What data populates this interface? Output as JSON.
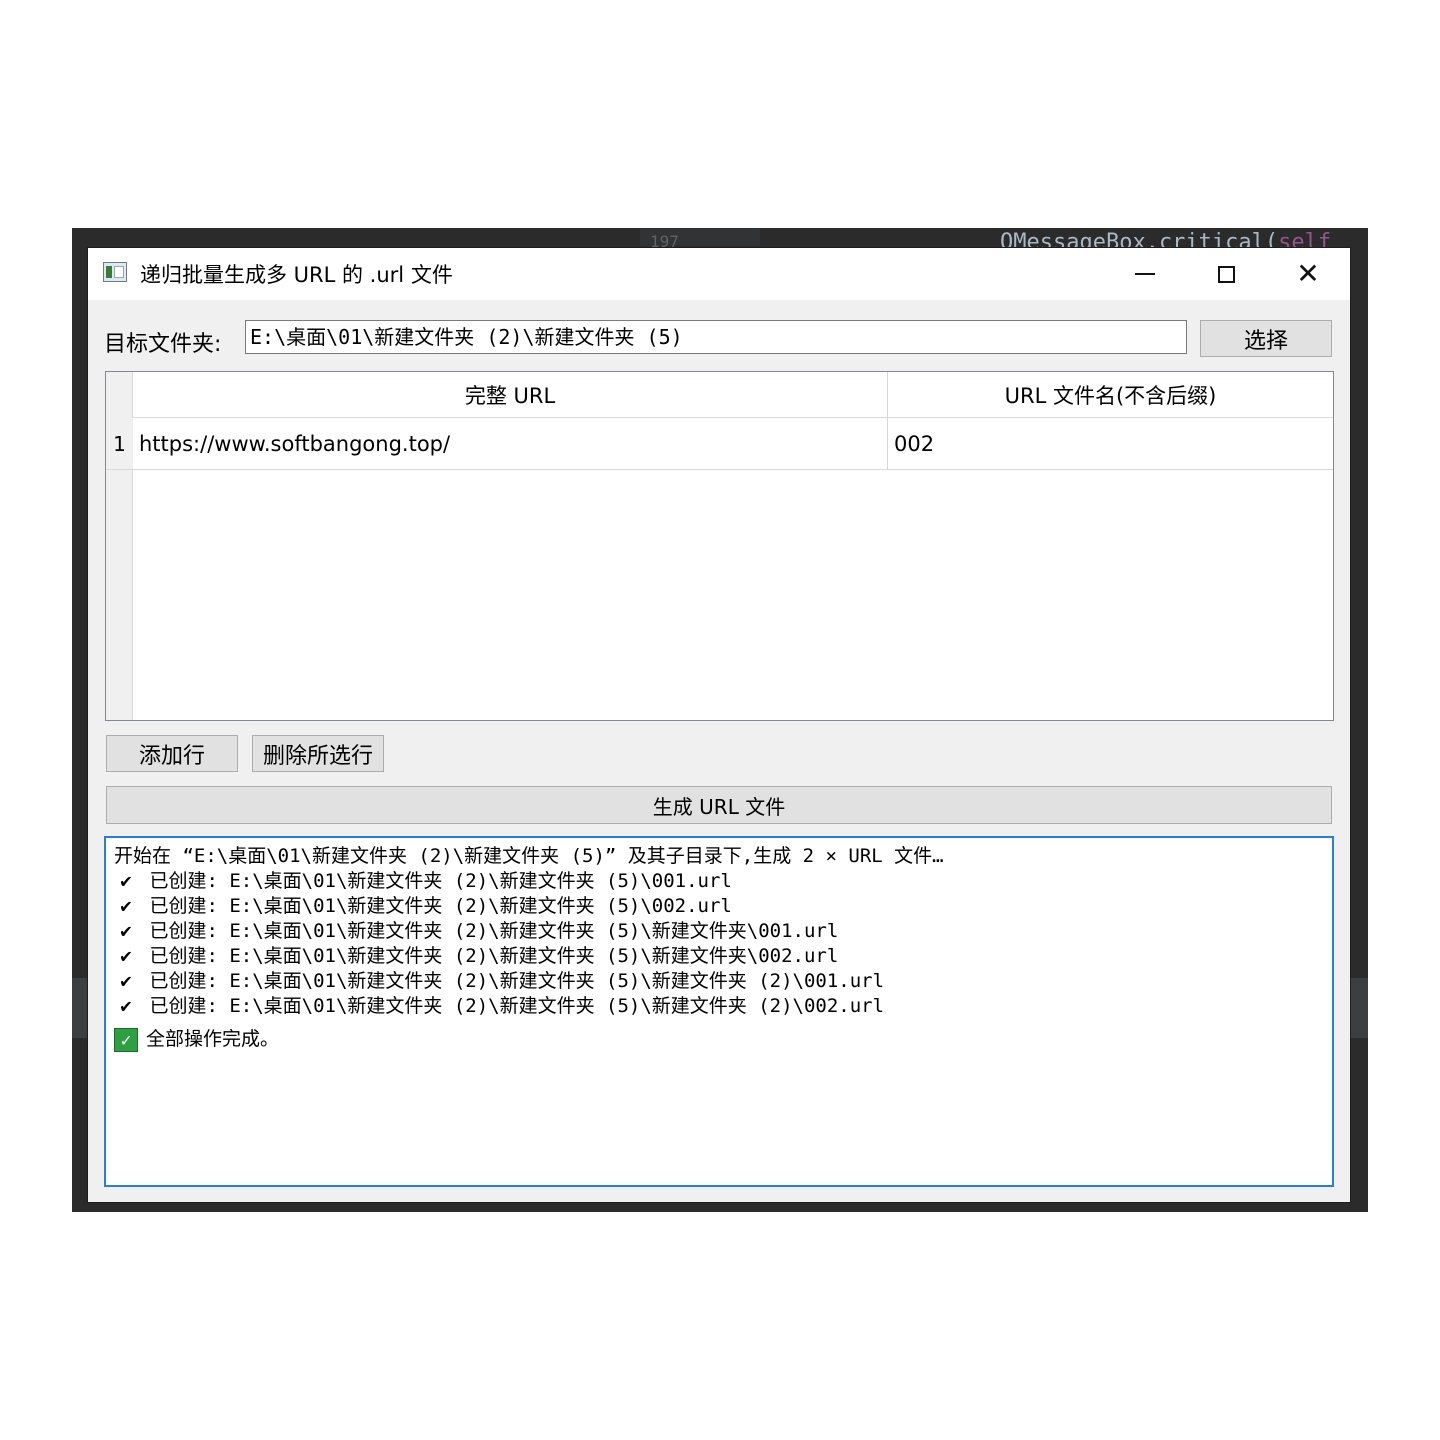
{
  "background": {
    "code_text": "QMessageBox.critical(",
    "code_self": "self",
    "line_number": "197"
  },
  "window": {
    "title": "递归批量生成多 URL 的 .url 文件"
  },
  "target": {
    "label": "目标文件夹:",
    "path": "E:\\桌面\\01\\新建文件夹 (2)\\新建文件夹 (5)",
    "select_button": "选择"
  },
  "table": {
    "columns": [
      "完整 URL",
      "URL 文件名(不含后缀)"
    ],
    "rows": [
      {
        "num": "1",
        "url": "https://www.softbangong.top/",
        "name": "002"
      }
    ]
  },
  "buttons": {
    "add_row": "添加行",
    "delete_selected": "删除所选行",
    "generate": "生成 URL 文件"
  },
  "log": {
    "start": "开始在 “E:\\桌面\\01\\新建文件夹 (2)\\新建文件夹 (5)” 及其子目录下,生成 2 × URL 文件…",
    "check_mark": "✔",
    "created": [
      "已创建: E:\\桌面\\01\\新建文件夹 (2)\\新建文件夹 (5)\\001.url",
      "已创建: E:\\桌面\\01\\新建文件夹 (2)\\新建文件夹 (5)\\002.url",
      "已创建: E:\\桌面\\01\\新建文件夹 (2)\\新建文件夹 (5)\\新建文件夹\\001.url",
      "已创建: E:\\桌面\\01\\新建文件夹 (2)\\新建文件夹 (5)\\新建文件夹\\002.url",
      "已创建: E:\\桌面\\01\\新建文件夹 (2)\\新建文件夹 (5)\\新建文件夹 (2)\\001.url",
      "已创建: E:\\桌面\\01\\新建文件夹 (2)\\新建文件夹 (5)\\新建文件夹 (2)\\002.url"
    ],
    "done": "全部操作完成。"
  },
  "colors": {
    "log_border": "#2a7fd4",
    "done_check": "#2ea043"
  }
}
